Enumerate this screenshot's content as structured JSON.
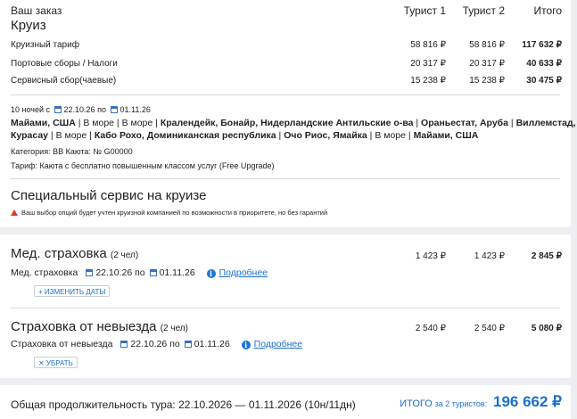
{
  "order": {
    "header": "Ваш заказ",
    "section_title": "Круиз",
    "columns": [
      "Турист 1",
      "Турист 2",
      "Итого"
    ],
    "rows": [
      {
        "label": "Круизный тариф",
        "t1": "58 816 ₽",
        "t2": "58 816 ₽",
        "total": "117 632 ₽"
      },
      {
        "label": "Портовые сборы / Налоги",
        "t1": "20 317 ₽",
        "t2": "20 317 ₽",
        "total": "40 633 ₽"
      },
      {
        "label": "Сервисный сбор(чаевые)",
        "t1": "15 238 ₽",
        "t2": "15 238 ₽",
        "total": "30 475 ₽"
      }
    ]
  },
  "cruise": {
    "nights_prefix": "10 ночей с",
    "date_from": "22.10.26",
    "by": "по",
    "date_to": "01.11.26",
    "route_line1_html": "<b>Майами, США</b> | В море | В море | <b>Кралендейк, Бонайр, Нидерландские Антильские о-ва</b> | <b>Ораньестат, Аруба</b> | <b>Виллемстад,",
    "route_line2_html": "<b>Курасау</b> | В море | <b>Кабо Рохо, Доминиканская республика</b> | <b>Очо Риос, Ямайка</b> | В море | <b>Майами, США</b>",
    "category": "Категория: BB   Каюта: № G00000",
    "tariff": "Тариф: Каюта с бесплатно повышенным классом услуг (Free Upgrade)"
  },
  "special": {
    "title": "Специальный сервис на круизе",
    "warning": "Ваш выбор опций будет учтен круизной компанией по возможности в приоритете, но без гарантий"
  },
  "medical": {
    "title": "Мед. страховка",
    "persons": "(2 чел)",
    "t1": "1 423 ₽",
    "t2": "1 423 ₽",
    "total": "2 845 ₽",
    "label": "Мед. страховка",
    "date_from": "22.10.26",
    "by": "по",
    "date_to": "01.11.26",
    "more": "Подробнее",
    "button": "+ ИЗМЕНИТЬ ДАТЫ"
  },
  "cancel": {
    "title": "Страховка от невыезда",
    "persons": "(2 чел)",
    "t1": "2 540 ₽",
    "t2": "2 540 ₽",
    "total": "5 080 ₽",
    "label": "Страховка от невыезда",
    "date_from": "22.10.26",
    "by": "по",
    "date_to": "01.11.26",
    "more": "Подробнее",
    "button": "✕ УБРАТЬ"
  },
  "footer": {
    "duration": "Общая продолжительность тура: 22.10.2026 — 01.11.2026 (10н/11дн)",
    "total_label": "ИТОГО",
    "total_sub": "за 2 туристов:",
    "total_value": "196 662 ₽"
  }
}
